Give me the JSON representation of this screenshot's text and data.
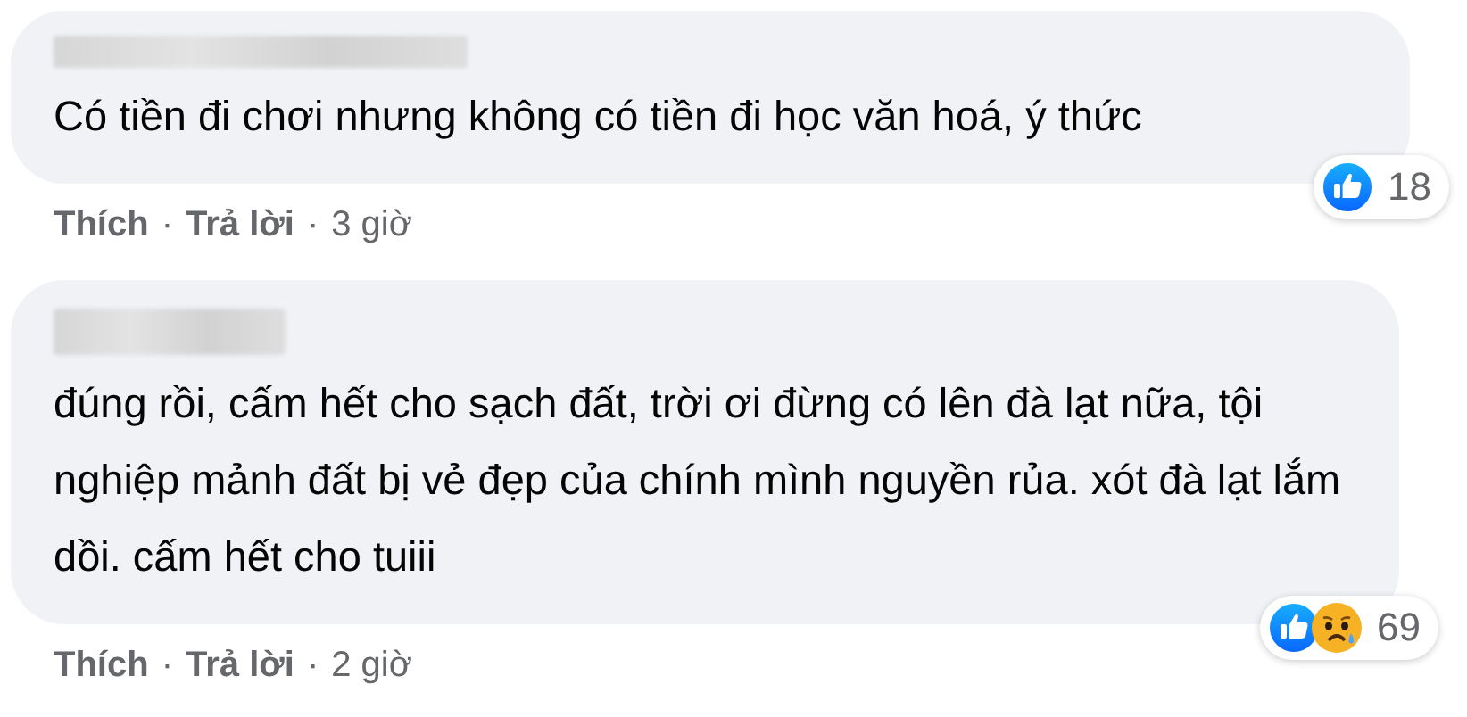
{
  "comments": [
    {
      "text": "Có tiền đi chơi nhưng không có tiền đi học văn hoá, ý thức",
      "reactions": [
        {
          "kind": "like"
        }
      ],
      "reaction_count": "18",
      "actions": [
        {
          "kind": "link",
          "text": "Thích"
        },
        {
          "kind": "dot",
          "text": "·"
        },
        {
          "kind": "link",
          "text": "Trả lời"
        },
        {
          "kind": "dot",
          "text": "·"
        },
        {
          "kind": "time",
          "text": "3 giờ"
        }
      ]
    },
    {
      "text": "đúng rồi, cấm hết cho sạch đất, trời ơi đừng có lên đà lạt nữa, tội nghiệp mảnh đất bị vẻ đẹp của chính mình nguyền rủa. xót đà lạt lắm dồi. cấm hết cho tuiii",
      "reactions": [
        {
          "kind": "like"
        },
        {
          "kind": "sad"
        }
      ],
      "reaction_count": "69",
      "actions": [
        {
          "kind": "link",
          "text": "Thích"
        },
        {
          "kind": "dot",
          "text": "·"
        },
        {
          "kind": "link",
          "text": "Trả lời"
        },
        {
          "kind": "dot",
          "text": "·"
        },
        {
          "kind": "time",
          "text": "2 giờ"
        }
      ]
    }
  ]
}
